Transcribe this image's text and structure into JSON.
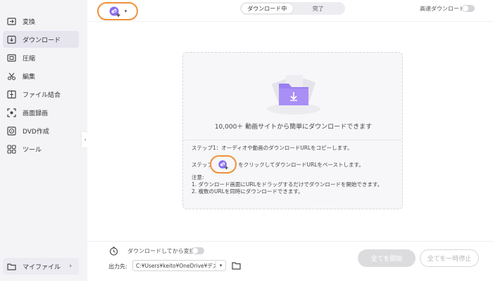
{
  "sidebar": {
    "items": [
      {
        "label": "変換",
        "icon": "convert-icon"
      },
      {
        "label": "ダウンロード",
        "icon": "download-icon",
        "active": true
      },
      {
        "label": "圧縮",
        "icon": "compress-icon"
      },
      {
        "label": "編集",
        "icon": "scissors-icon"
      },
      {
        "label": "ファイル結合",
        "icon": "merge-icon"
      },
      {
        "label": "画面録画",
        "icon": "screen-record-icon"
      },
      {
        "label": "DVD作成",
        "icon": "dvd-icon"
      },
      {
        "label": "ツール",
        "icon": "tools-icon"
      }
    ],
    "collapse_glyph": "‹",
    "my_files": {
      "label": "マイファイル",
      "arrow": "›"
    }
  },
  "header": {
    "tabs": [
      "ダウンロード中",
      "完了"
    ],
    "active_tab": 0,
    "high_speed_label": "高速ダウンロード",
    "high_speed_on": false
  },
  "dropzone": {
    "headline": "10,000＋ 動画サイトから簡単にダウンロードできます",
    "step1": "ステップ1：オーディオや動画のダウンロードURLをコピーします。",
    "step2_prefix": "ステップ2：",
    "step2_suffix": "をクリックしてダウンロードURLをペーストします。",
    "note_title": "注意:",
    "note1": "1. ダウンロード画面にURLをドラッグするだけでダウンロードを開始できます。",
    "note2": "2. 複数のURLを同時にダウンロードできます。"
  },
  "footer": {
    "download_convert_label": "ダウンロードしてから変換",
    "download_convert_on": false,
    "output_label": "出力先:",
    "output_path": "C:¥Users¥keito¥OneDrive¥デスク",
    "start_all": "全てを開始",
    "pause_all": "全てを一時停止"
  },
  "colors": {
    "accent": "#8b6cf0",
    "highlight_ring": "#f0913a"
  }
}
